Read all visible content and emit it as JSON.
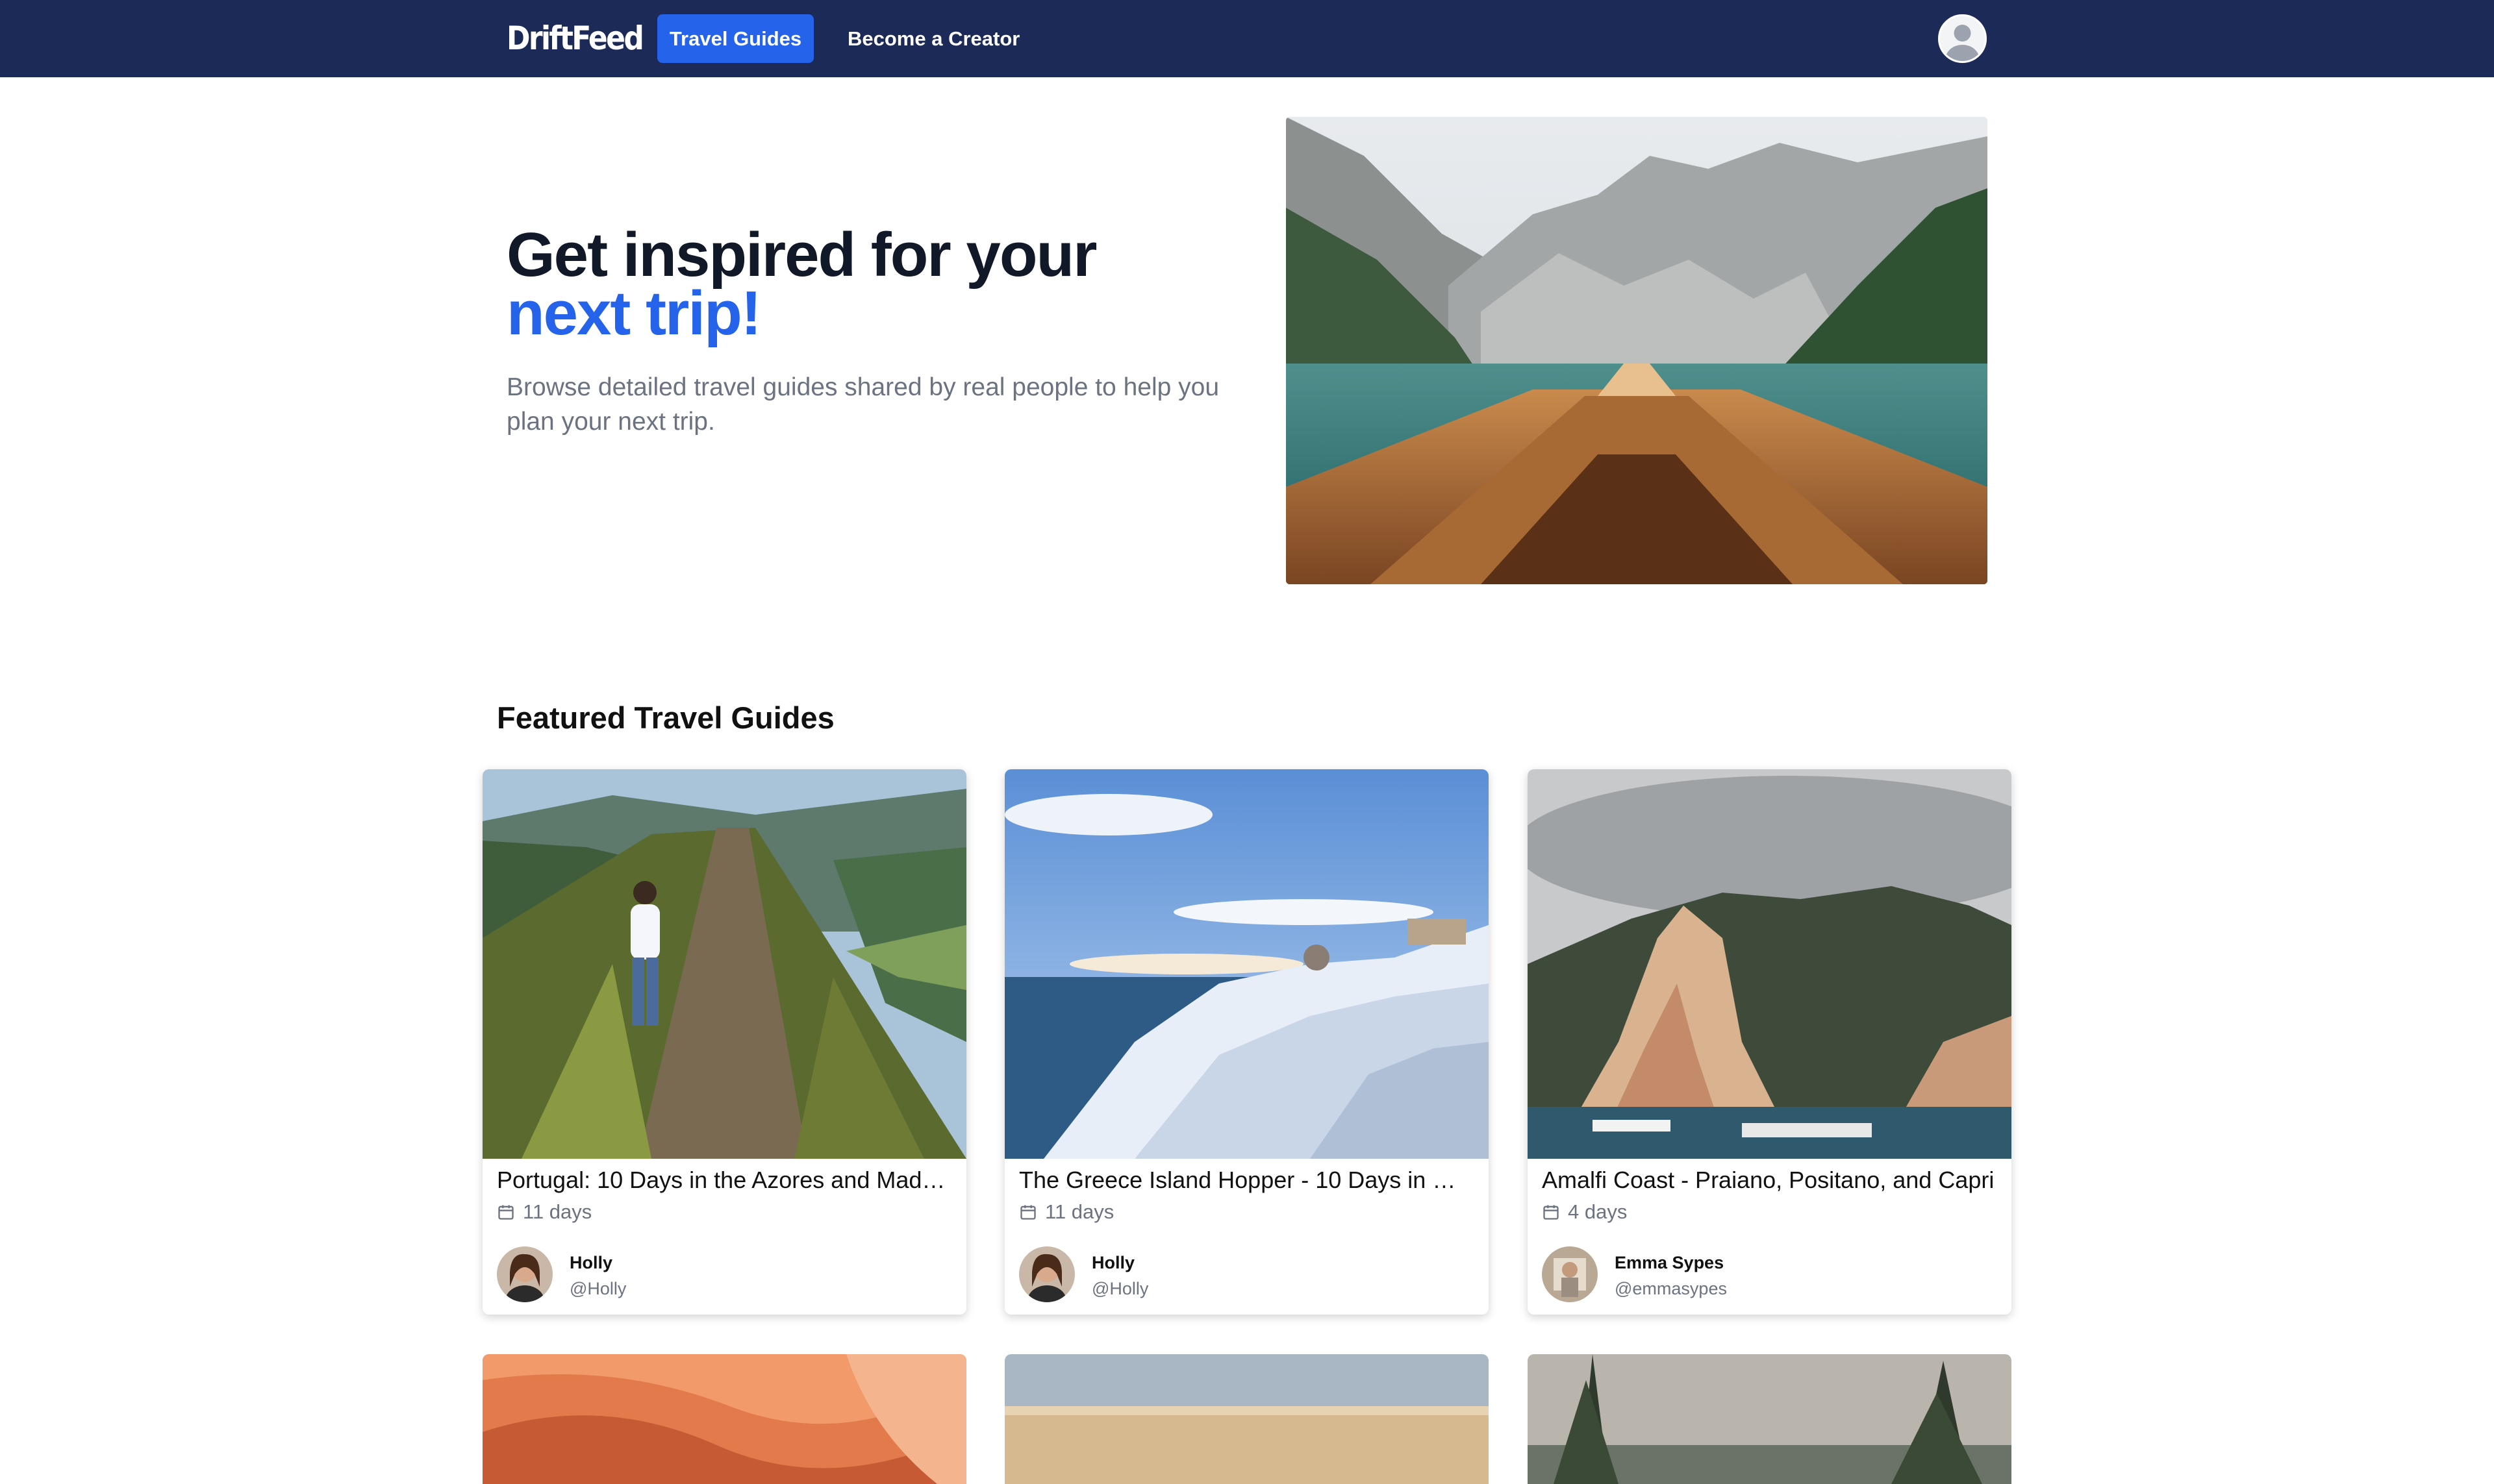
{
  "navbar": {
    "brand": "DriftFeed",
    "links": [
      {
        "label": "Travel Guides",
        "active": true
      },
      {
        "label": "Become a Creator",
        "active": false
      }
    ],
    "profile_icon": "user-avatar-icon"
  },
  "hero": {
    "title_line1": "Get inspired for your",
    "title_line2": "next trip!",
    "subtitle": "Browse detailed travel guides shared by real people to help you plan your next trip.",
    "image": "mountain-lake-boat-photo"
  },
  "featured": {
    "heading": "Featured Travel Guides",
    "cards": [
      {
        "title": "Portugal: 10 Days in the Azores and Made...",
        "duration": "11 days",
        "author_name": "Holly",
        "author_handle": "@Holly",
        "image": "azores-ridge-hiker-photo"
      },
      {
        "title": "The Greece Island Hopper - 10 Days in Gr...",
        "duration": "11 days",
        "author_name": "Holly",
        "author_handle": "@Holly",
        "image": "santorini-village-photo"
      },
      {
        "title": "Amalfi Coast - Praiano, Positano, and Capri",
        "duration": "4 days",
        "author_name": "Emma Sypes",
        "author_handle": "@emmasypes",
        "image": "positano-coast-photo"
      }
    ],
    "partial_cards": [
      "canyon-photo",
      "beach-sunset-photo",
      "forest-lake-photo"
    ]
  },
  "colors": {
    "navbar_bg": "#1b2a57",
    "accent": "#2563eb",
    "text_dark": "#111827",
    "text_muted": "#6b7280"
  }
}
